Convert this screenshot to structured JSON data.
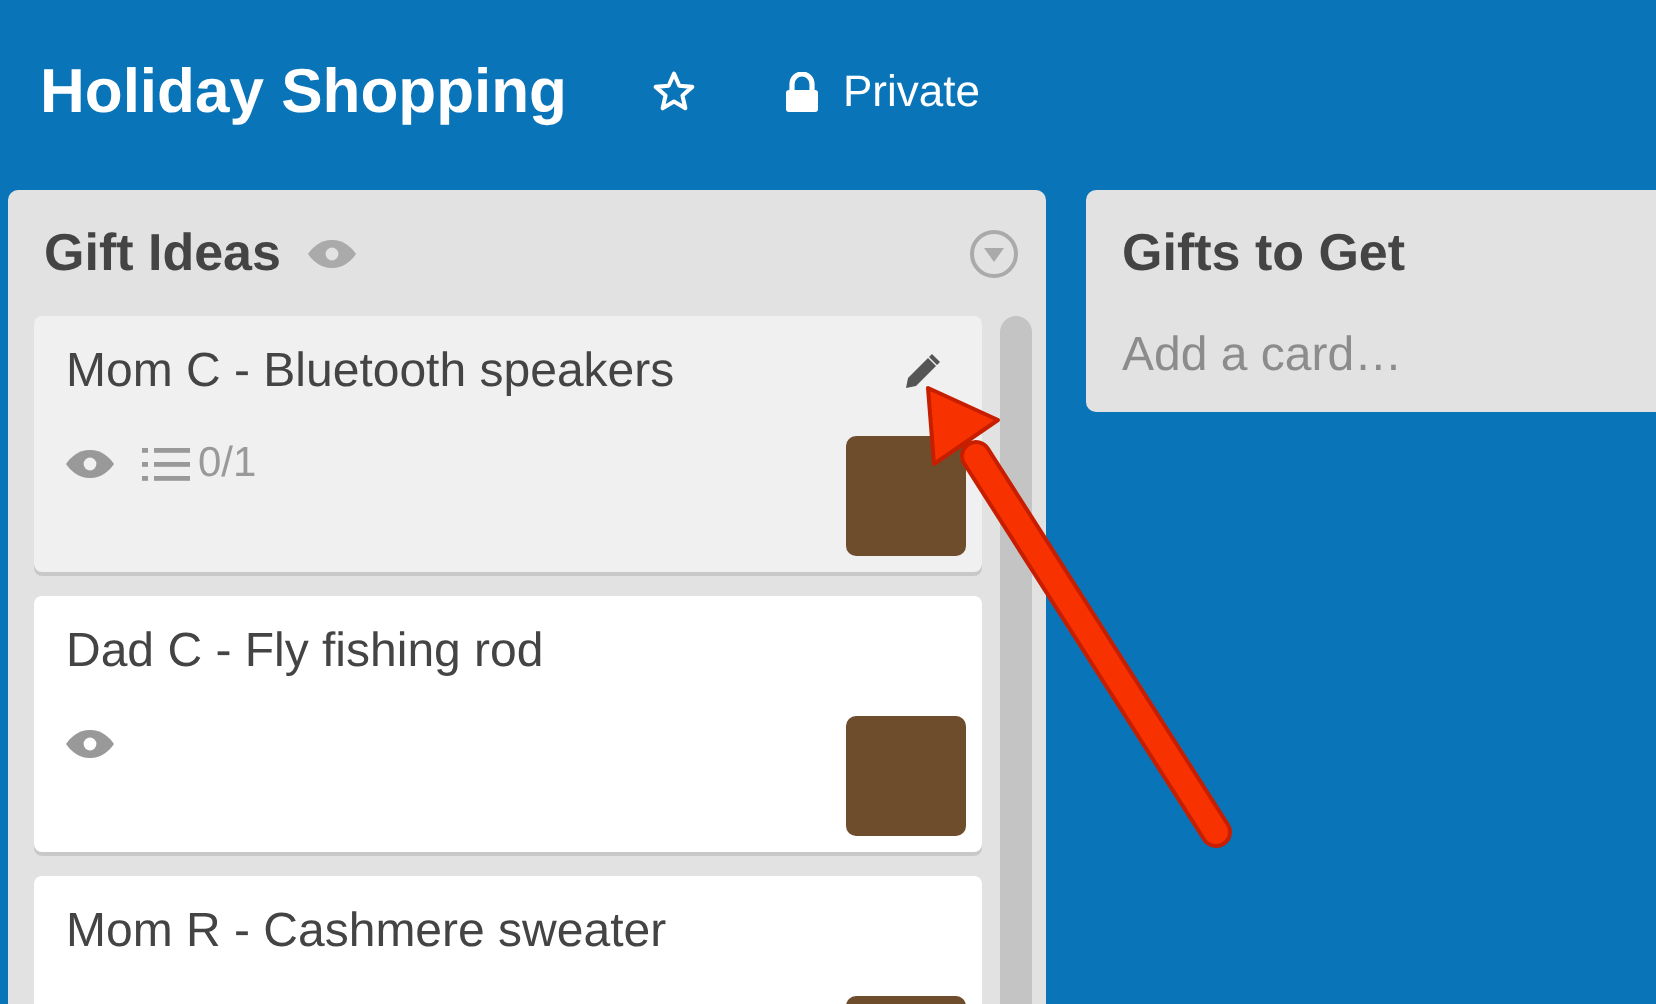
{
  "board": {
    "title": "Holiday Shopping",
    "starred": false,
    "visibility": "Private"
  },
  "lists": [
    {
      "title": "Gift Ideas",
      "watching": true,
      "cards": [
        {
          "title": "Mom C - Bluetooth speakers",
          "hovered": true,
          "watching": true,
          "checklist": "0/1",
          "avatar": true
        },
        {
          "title": "Dad C - Fly fishing rod",
          "hovered": false,
          "watching": true,
          "avatar": true
        },
        {
          "title": "Mom R - Cashmere sweater",
          "hovered": false,
          "watching": false,
          "avatar": true
        }
      ]
    },
    {
      "title": "Gifts to Get",
      "watching": false,
      "add_card": "Add a card…"
    }
  ],
  "annotation_arrow": true
}
